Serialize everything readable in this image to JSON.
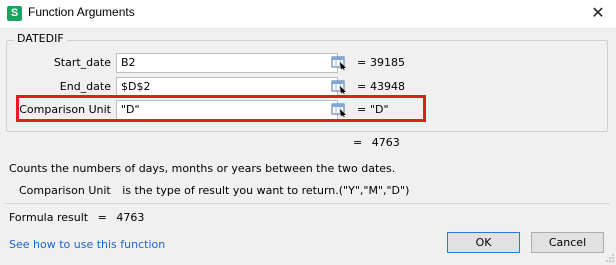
{
  "window": {
    "title": "Function Arguments",
    "close_glyph": "✕",
    "app_icon_letter": "S",
    "app_icon_color": "#1aa260"
  },
  "function_name": "DATEDIF",
  "arguments": [
    {
      "label": "Start_date",
      "value": "B2",
      "result": "39185"
    },
    {
      "label": "End_date",
      "value": "$D$2",
      "result": "43948"
    },
    {
      "label": "Comparison Unit",
      "value": "\"D\"",
      "result": "\"D\""
    }
  ],
  "equals_sign": "=",
  "function_result": "4763",
  "description": "Counts the numbers of days, months or years between the two dates.",
  "parameter_help": {
    "name": "Comparison Unit",
    "text": "is the type of result you want to return.(\"Y\",\"M\",\"D\")"
  },
  "formula_result_label": "Formula result",
  "formula_result_value": "4763",
  "help_link": "See how to use this function",
  "buttons": {
    "ok": "OK",
    "cancel": "Cancel"
  },
  "colors": {
    "highlight": "#e31b23",
    "link": "#1f62c6"
  },
  "icons": {
    "ref_selector": "range-select-icon",
    "close": "close-icon",
    "grip": "resize-grip-icon"
  }
}
